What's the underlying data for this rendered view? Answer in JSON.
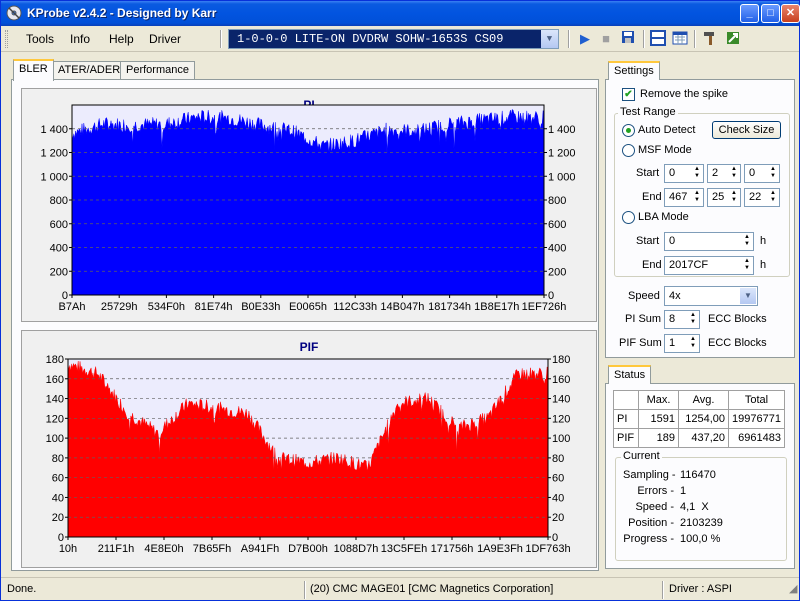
{
  "window": {
    "title": "KProbe v2.4.2 - Designed by Karr"
  },
  "title_buttons": {
    "minimize": "_",
    "maximize": "□",
    "close": "✕"
  },
  "menu": [
    "Tools",
    "Info",
    "Help",
    "Driver"
  ],
  "drive": {
    "selected": "1-0-0-0 LITE-ON DVDRW SOHW-1653S CS09"
  },
  "toolbar": [
    "play-icon",
    "stop-icon",
    "save-icon",
    "layout-icon",
    "calendar-icon",
    "hammer-icon",
    "exit-icon"
  ],
  "tabs": [
    "BLER",
    "ATER/ADER",
    "Performance"
  ],
  "colors": {
    "pi": "#0000ff",
    "pif": "#ff0000",
    "plot_bg": "#ececfd",
    "title": "#000080"
  },
  "pi_chart": {
    "title": "PI",
    "y_ticks": [
      "0",
      "200",
      "400",
      "600",
      "800",
      "1 000",
      "1 200",
      "1 400"
    ],
    "x_ticks": [
      "B7Ah",
      "25729h",
      "534F0h",
      "81E74h",
      "B0E33h",
      "E0065h",
      "112C33h",
      "14B047h",
      "181734h",
      "1B8E17h",
      "1EF726h"
    ]
  },
  "pif_chart": {
    "title": "PIF",
    "y_ticks": [
      "0",
      "20",
      "40",
      "60",
      "80",
      "100",
      "120",
      "140",
      "160",
      "180"
    ],
    "x_ticks": [
      "10h",
      "211F1h",
      "4E8E0h",
      "7B65Fh",
      "A941Fh",
      "D7B00h",
      "1088D7h",
      "13C5FEh",
      "171756h",
      "1A9E3Fh",
      "1DF763h"
    ]
  },
  "chart_data": [
    {
      "type": "area",
      "title": "PI",
      "xlabel": "",
      "ylabel": "",
      "ylim": [
        0,
        1600
      ],
      "grid": true,
      "categories": [
        "B7Ah",
        "25729h",
        "534F0h",
        "81E74h",
        "B0E33h",
        "E0065h",
        "112C33h",
        "14B047h",
        "181734h",
        "1B8E17h",
        "1EF726h"
      ],
      "series": [
        {
          "values": [
            1360,
            1440,
            1430,
            1440,
            1500,
            1490,
            1430,
            1380,
            1250,
            1300,
            1390,
            1380,
            1440,
            1470,
            1500,
            1490
          ]
        }
      ]
    },
    {
      "type": "area",
      "title": "PIF",
      "xlabel": "",
      "ylabel": "",
      "ylim": [
        0,
        180
      ],
      "grid": true,
      "categories": [
        "10h",
        "211F1h",
        "4E8E0h",
        "7B65Fh",
        "A941Fh",
        "D7B00h",
        "1088D7h",
        "13C5FEh",
        "171756h",
        "1A9E3Fh",
        "1DF763h"
      ],
      "series": [
        {
          "values": [
            175,
            165,
            125,
            105,
            135,
            130,
            125,
            80,
            75,
            80,
            70,
            135,
            140,
            110,
            120,
            165,
            165
          ]
        }
      ]
    }
  ],
  "settings": {
    "tab": "Settings",
    "remove_spike": "Remove the spike",
    "test_range": "Test Range",
    "auto_detect": "Auto Detect",
    "check_size": "Check Size",
    "msf_mode": "MSF Mode",
    "start_label": "Start",
    "end_label": "End",
    "msf_start": [
      "0",
      "2",
      "0"
    ],
    "msf_end": [
      "467",
      "25",
      "22"
    ],
    "lba_mode": "LBA Mode",
    "lba_start": "0",
    "lba_end": "2017CF",
    "h_unit": "h",
    "speed_label": "Speed",
    "speed_value": "4x",
    "pi_sum_label": "PI Sum",
    "pi_sum_value": "8",
    "pif_sum_label": "PIF Sum",
    "pif_sum_value": "1",
    "ecc_blocks": "ECC Blocks"
  },
  "status": {
    "tab": "Status",
    "headers": [
      "Max.",
      "Avg.",
      "Total"
    ],
    "rows": [
      {
        "label": "PI",
        "max": "1591",
        "avg": "1254,00",
        "total": "19976771"
      },
      {
        "label": "PIF",
        "max": "189",
        "avg": "437,20",
        "total": "6961483"
      }
    ],
    "current_label": "Current",
    "current": [
      {
        "label": "Sampling -",
        "value": "116470"
      },
      {
        "label": "Errors -",
        "value": "1"
      },
      {
        "label": "Speed -",
        "value": "4,1  X"
      },
      {
        "label": "Position -",
        "value": "2103239"
      },
      {
        "label": "Progress -",
        "value": "100,0 %"
      }
    ]
  },
  "statusbar": {
    "left": "Done.",
    "middle": "(20) CMC MAGE01 [CMC Magnetics Corporation]",
    "right": "Driver : ASPI"
  }
}
